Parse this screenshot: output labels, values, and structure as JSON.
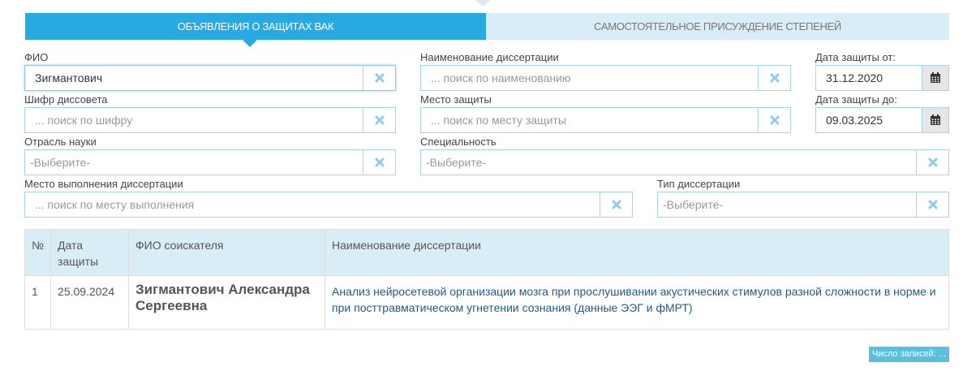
{
  "tabs": [
    {
      "label": "ОБЪЯВЛЕНИЯ О ЗАЩИТАХ ВАК",
      "active": true
    },
    {
      "label": "САМОСТОЯТЕЛЬНОЕ ПРИСУЖДЕНИЕ СТЕПЕНЕЙ",
      "active": false
    }
  ],
  "filters": {
    "fio": {
      "label": "ФИО",
      "value": "Зигмантович"
    },
    "title": {
      "label": "Наименование диссертации",
      "placeholder": "... поиск по наименованию"
    },
    "date_from": {
      "label": "Дата защиты от:",
      "value": "31.12.2020"
    },
    "council": {
      "label": "Шифр диссовета",
      "placeholder": "... поиск по шифру"
    },
    "place": {
      "label": "Место защиты",
      "placeholder": "... поиск по месту защиты"
    },
    "date_to": {
      "label": "Дата защиты до:",
      "value": "09.03.2025"
    },
    "branch": {
      "label": "Отрасль науки",
      "placeholder": "-Выберите-"
    },
    "specialty": {
      "label": "Специальность",
      "placeholder": "-Выберите-"
    },
    "work_place": {
      "label": "Место выполнения диссертации",
      "placeholder": "... поиск по месту выполнения"
    },
    "type": {
      "label": "Тип диссертации",
      "placeholder": "-Выберите-"
    }
  },
  "table": {
    "headers": {
      "num": "№",
      "date": "Дата защиты",
      "fio": "ФИО соискателя",
      "title": "Наименование диссертации"
    },
    "rows": [
      {
        "num": "1",
        "date": "25.09.2024",
        "fio": "Зигмантович Александра Сергеевна",
        "title": "Анализ нейросетевой организации мозга при прослушивании акустических стимулов разной сложности в норме и при посттравматическом угнетении сознания (данные ЭЭГ и фМРТ)"
      }
    ]
  },
  "records_badge": "Число записей: ...",
  "colors": {
    "accent": "#27a9e1",
    "tab_inactive_bg": "#d9edf7",
    "clear_icon": "#8fcbec",
    "link": "#1f5a8c",
    "badge": "#5bc0de"
  },
  "icons": {
    "clear": "times-icon",
    "calendar": "calendar-icon"
  }
}
